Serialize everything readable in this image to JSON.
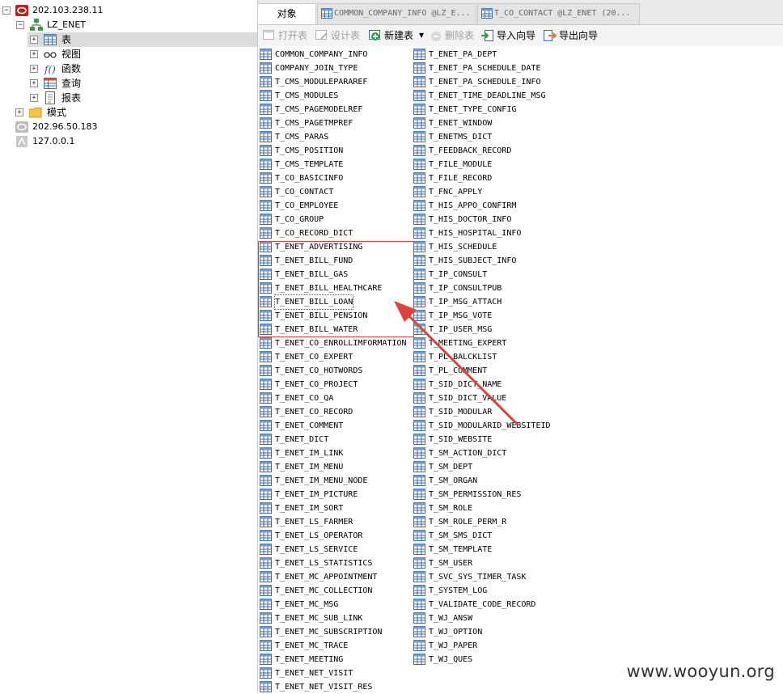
{
  "tree": {
    "connection_main": "202.103.238.11",
    "schema_user": "LZ_ENET",
    "nodes": {
      "tables": "表",
      "views": "视图",
      "functions": "函数",
      "queries": "查询",
      "reports": "报表"
    },
    "mode": "模式",
    "connection_2": "202.96.50.183",
    "connection_3": "127.0.0.1"
  },
  "tabs": [
    "对象",
    "COMMON_COMPANY_INFO @LZ_E...",
    "T_CO_CONTACT @LZ_ENET (20..."
  ],
  "toolbar": {
    "open_table": "打开表",
    "design_table": "设计表",
    "new_table": "新建表",
    "delete_table": "删除表",
    "import_wizard": "导入向导",
    "export_wizard": "导出向导"
  },
  "tables_col1": [
    "COMMON_COMPANY_INFO",
    "COMPANY_JOIN_TYPE",
    "T_CMS_MODULEPARAREF",
    "T_CMS_MODULES",
    "T_CMS_PAGEMODELREF",
    "T_CMS_PAGETMPREF",
    "T_CMS_PARAS",
    "T_CMS_POSITION",
    "T_CMS_TEMPLATE",
    "T_CO_BASICINFO",
    "T_CO_CONTACT",
    "T_CO_EMPLOYEE",
    "T_CO_GROUP",
    "T_CO_RECORD_DICT",
    "T_ENET_ADVERTISING",
    "T_ENET_BILL_FUND",
    "T_ENET_BILL_GAS",
    "T_ENET_BILL_HEALTHCARE",
    "T_ENET_BILL_LOAN",
    "T_ENET_BILL_PENSION",
    "T_ENET_BILL_WATER",
    "T_ENET_CO_ENROLLIMFORMATION",
    "T_ENET_CO_EXPERT",
    "T_ENET_CO_HOTWORDS",
    "T_ENET_CO_PROJECT",
    "T_ENET_CO_QA",
    "T_ENET_CO_RECORD",
    "T_ENET_COMMENT",
    "T_ENET_DICT",
    "T_ENET_IM_LINK",
    "T_ENET_IM_MENU",
    "T_ENET_IM_MENU_NODE",
    "T_ENET_IM_PICTURE",
    "T_ENET_IM_SORT",
    "T_ENET_LS_FARMER",
    "T_ENET_LS_OPERATOR",
    "T_ENET_LS_SERVICE",
    "T_ENET_LS_STATISTICS",
    "T_ENET_MC_APPOINTMENT",
    "T_ENET_MC_COLLECTION",
    "T_ENET_MC_MSG",
    "T_ENET_MC_SUB_LINK",
    "T_ENET_MC_SUBSCRIPTION",
    "T_ENET_MC_TRACE",
    "T_ENET_MEETING",
    "T_ENET_NET_VISIT",
    "T_ENET_NET_VISIT_RES"
  ],
  "tables_col2": [
    "T_ENET_PA_DEPT",
    "T_ENET_PA_SCHEDULE_DATE",
    "T_ENET_PA_SCHEDULE_INFO",
    "T_ENET_TIME_DEADLINE_MSG",
    "T_ENET_TYPE_CONFIG",
    "T_ENET_WINDOW",
    "T_ENETMS_DICT",
    "T_FEEDBACK_RECORD",
    "T_FILE_MODULE",
    "T_FILE_RECORD",
    "T_FNC_APPLY",
    "T_HIS_APPO_CONFIRM",
    "T_HIS_DOCTOR_INFO",
    "T_HIS_HOSPITAL_INFO",
    "T_HIS_SCHEDULE",
    "T_HIS_SUBJECT_INFO",
    "T_IP_CONSULT",
    "T_IP_CONSULTPUB",
    "T_IP_MSG_ATTACH",
    "T_IP_MSG_VOTE",
    "T_IP_USER_MSG",
    "T_MEETING_EXPERT",
    "T_PL_BALCKLIST",
    "T_PL_COMMENT",
    "T_SID_DICT_NAME",
    "T_SID_DICT_VALUE",
    "T_SID_MODULAR",
    "T_SID_MODULARID_WEBSITEID",
    "T_SID_WEBSITE",
    "T_SM_ACTION_DICT",
    "T_SM_DEPT",
    "T_SM_ORGAN",
    "T_SM_PERMISSION_RES",
    "T_SM_ROLE",
    "T_SM_ROLE_PERM_R",
    "T_SM_SMS_DICT",
    "T_SM_TEMPLATE",
    "T_SM_USER",
    "T_SVC_SYS_TIMER_TASK",
    "T_SYSTEM_LOG",
    "T_VALIDATE_CODE_RECORD",
    "T_WJ_ANSW",
    "T_WJ_OPTION",
    "T_WJ_PAPER",
    "T_WJ_QUES"
  ],
  "selected_table": "T_ENET_BILL_LOAN",
  "colors": {
    "highlight": "#e0413a",
    "selection": "#dcdcdc",
    "server_icon": "#c0201a"
  },
  "watermark": "www.wooyun.org"
}
